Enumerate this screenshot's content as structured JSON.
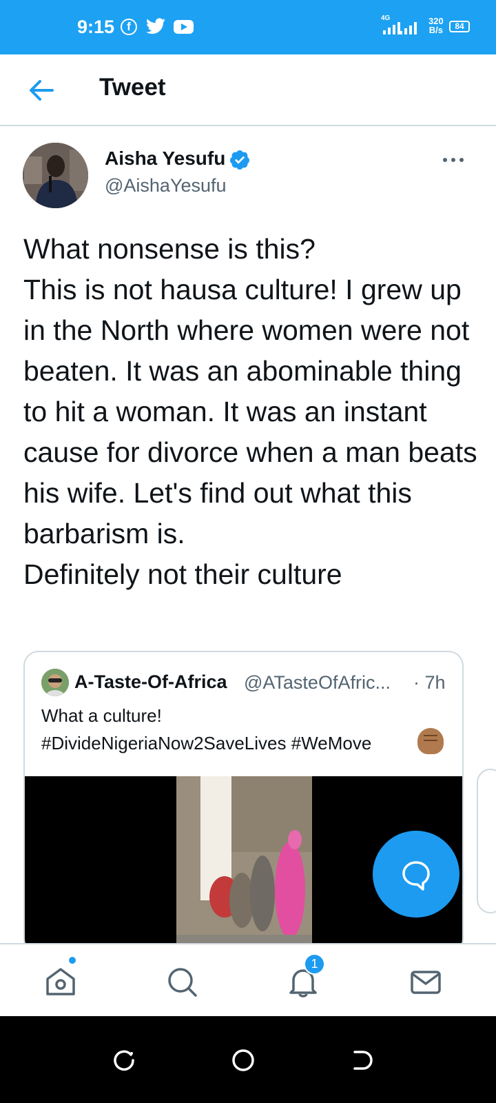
{
  "status_bar": {
    "time": "9:15",
    "network": "4G",
    "speed_value": "320",
    "speed_unit": "B/s",
    "battery": "84",
    "icons": [
      "facebook-icon",
      "twitter-icon",
      "youtube-icon",
      "signal-icon",
      "battery-icon"
    ]
  },
  "header": {
    "title": "Tweet",
    "back_icon": "arrow-left-icon"
  },
  "tweet": {
    "author_name": "Aisha Yesufu",
    "author_handle": "@AishaYesufu",
    "verified": true,
    "text": "What nonsense is this?\nThis is not hausa culture! I grew up in the North where women were not beaten. It was an abominable thing to hit a woman. It was an instant cause for divorce when a man beats his wife. Let's find out what this barbarism is.\nDefinitely not their culture"
  },
  "quote": {
    "author_name": "A-Taste-Of-Africa",
    "author_handle": "@ATasteOfAfric...",
    "time": "· 7h",
    "text": "What a culture!\n#DivideNigeriaNow2SaveLives #WeMove"
  },
  "bottom_nav": {
    "items": [
      "home-icon",
      "search-icon",
      "notifications-icon",
      "messages-icon"
    ],
    "notification_count": "1"
  },
  "colors": {
    "accent": "#1d9bf0",
    "status_bar": "#1da1f2",
    "secondary_text": "#536471",
    "border": "#cfd9de"
  }
}
